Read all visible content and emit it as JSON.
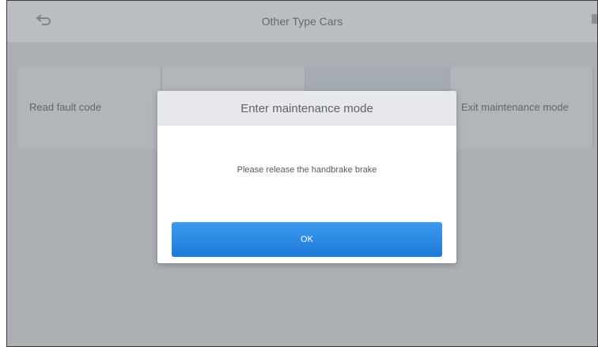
{
  "header": {
    "back_icon": "back-arrow-icon",
    "title": "Other Type Cars",
    "right_icon": "settings-icon"
  },
  "breadcrumb": "",
  "tiles": [
    {
      "label": "Read fault code"
    },
    {
      "label": ""
    },
    {
      "label": ""
    },
    {
      "label": "Exit maintenance mode"
    }
  ],
  "dialog": {
    "title": "Enter maintenance mode",
    "message": "Please release the handbrake brake",
    "ok_label": "OK"
  },
  "colors": {
    "primary_button": "#2b8ae6",
    "dialog_header": "#e6e8eb",
    "overlay_background": "#bfc3c8"
  }
}
